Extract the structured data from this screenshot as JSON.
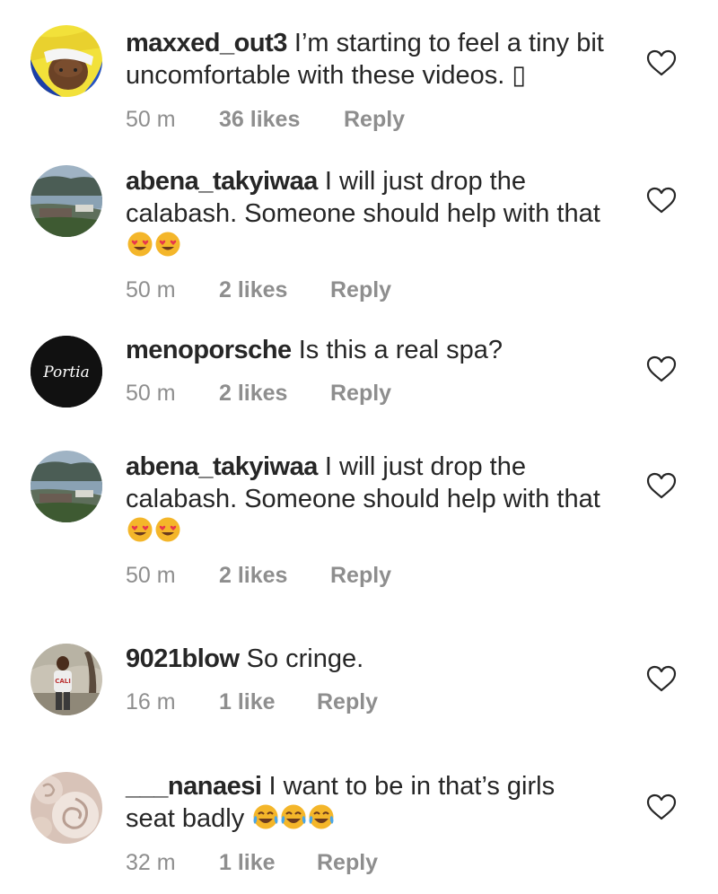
{
  "comments": [
    {
      "username": "maxxed_out3",
      "text": "I’m starting to feel a tiny bit uncomfortable with these videos. ",
      "trailing_glyph": "▯",
      "time": "50 m",
      "likes": "36 likes",
      "reply": "Reply",
      "avatar": "avatar-yellow-scarf-person",
      "emojis": []
    },
    {
      "username": "abena_takyiwaa",
      "text": "I will just drop the calabash. Someone should help with that",
      "time": "50 m",
      "likes": "2 likes",
      "reply": "Reply",
      "avatar": "avatar-lake-landscape",
      "emojis": [
        "heart-eyes-emoji",
        "heart-eyes-emoji"
      ]
    },
    {
      "username": "menoporsche",
      "text": "Is this a real spa?",
      "time": "50 m",
      "likes": "2 likes",
      "reply": "Reply",
      "avatar": "avatar-portia-script-logo",
      "avatar_text": "Portia",
      "emojis": []
    },
    {
      "username": "abena_takyiwaa",
      "text": "I will just drop the calabash. Someone should help with that",
      "time": "50 m",
      "likes": "2 likes",
      "reply": "Reply",
      "avatar": "avatar-lake-landscape",
      "emojis": [
        "heart-eyes-emoji",
        "heart-eyes-emoji"
      ]
    },
    {
      "username": "9021blow",
      "text": "So cringe.",
      "time": "16 m",
      "likes": "1 like",
      "reply": "Reply",
      "avatar": "avatar-man-outdoors",
      "emojis": []
    },
    {
      "username": "___nanaesi",
      "text": "I want to be in that’s girls seat badly ",
      "time": "32 m",
      "likes": "1 like",
      "reply": "Reply",
      "avatar": "avatar-white-roses",
      "emojis": [
        "tears-of-joy-emoji",
        "tears-of-joy-emoji",
        "tears-of-joy-emoji"
      ]
    }
  ],
  "colors": {
    "text": "#262626",
    "secondary": "#8e8e8e",
    "heart_outline": "#262626",
    "emoji_face": "#f4b62a",
    "emoji_heart": "#e8374b"
  },
  "icons": {
    "like": "heart-outline-icon"
  }
}
